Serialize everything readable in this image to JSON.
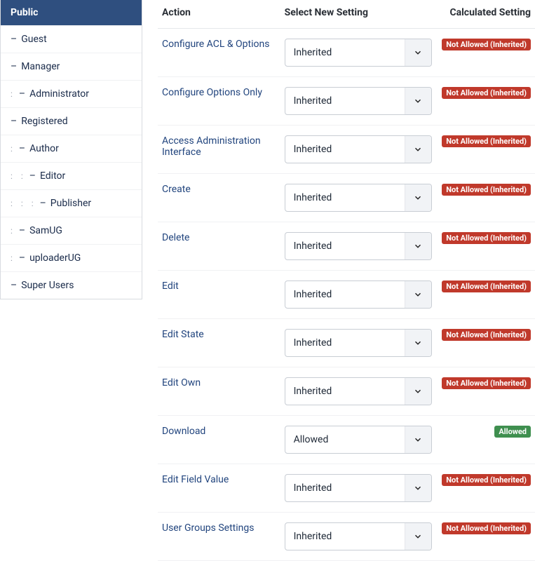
{
  "sidebar": {
    "header": "Public",
    "items": [
      {
        "label": "Guest",
        "depth": 0
      },
      {
        "label": "Manager",
        "depth": 0
      },
      {
        "label": "Administrator",
        "depth": 1
      },
      {
        "label": "Registered",
        "depth": 0
      },
      {
        "label": "Author",
        "depth": 1
      },
      {
        "label": "Editor",
        "depth": 2
      },
      {
        "label": "Publisher",
        "depth": 3
      },
      {
        "label": "SamUG",
        "depth": 1
      },
      {
        "label": "uploaderUG",
        "depth": 1
      },
      {
        "label": "Super Users",
        "depth": 0
      }
    ]
  },
  "table": {
    "headers": {
      "action": "Action",
      "select": "Select New Setting",
      "calculated": "Calculated Setting"
    },
    "rows": [
      {
        "action": "Configure ACL & Options",
        "setting": "Inherited",
        "calculated": "Not Allowed (Inherited)",
        "color": "red"
      },
      {
        "action": "Configure Options Only",
        "setting": "Inherited",
        "calculated": "Not Allowed (Inherited)",
        "color": "red"
      },
      {
        "action": "Access Administration Interface",
        "setting": "Inherited",
        "calculated": "Not Allowed (Inherited)",
        "color": "red"
      },
      {
        "action": "Create",
        "setting": "Inherited",
        "calculated": "Not Allowed (Inherited)",
        "color": "red"
      },
      {
        "action": "Delete",
        "setting": "Inherited",
        "calculated": "Not Allowed (Inherited)",
        "color": "red"
      },
      {
        "action": "Edit",
        "setting": "Inherited",
        "calculated": "Not Allowed (Inherited)",
        "color": "red"
      },
      {
        "action": "Edit State",
        "setting": "Inherited",
        "calculated": "Not Allowed (Inherited)",
        "color": "red"
      },
      {
        "action": "Edit Own",
        "setting": "Inherited",
        "calculated": "Not Allowed (Inherited)",
        "color": "red"
      },
      {
        "action": "Download",
        "setting": "Allowed",
        "calculated": "Allowed",
        "color": "green"
      },
      {
        "action": "Edit Field Value",
        "setting": "Inherited",
        "calculated": "Not Allowed (Inherited)",
        "color": "red"
      },
      {
        "action": "User Groups Settings",
        "setting": "Inherited",
        "calculated": "Not Allowed (Inherited)",
        "color": "red"
      }
    ]
  }
}
